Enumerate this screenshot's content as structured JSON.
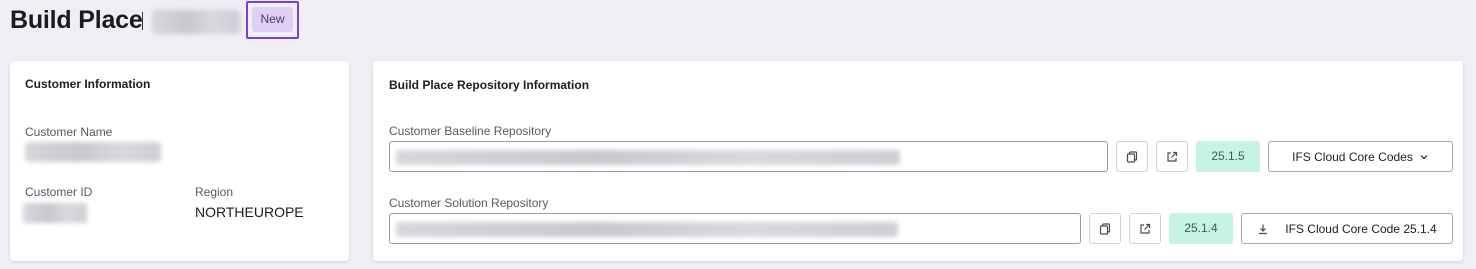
{
  "header": {
    "title": "Build Place",
    "status_badge": "New"
  },
  "customer_card": {
    "title": "Customer Information",
    "name_label": "Customer Name",
    "id_label": "Customer ID",
    "region_label": "Region",
    "region_value": "NORTHEUROPE"
  },
  "repo_card": {
    "title": "Build Place Repository Information",
    "baseline": {
      "label": "Customer Baseline Repository",
      "version": "25.1.5",
      "action_label": "IFS Cloud Core Codes",
      "action_icon": "chevron-down-icon"
    },
    "solution": {
      "label": "Customer Solution Repository",
      "version": "25.1.4",
      "action_label": "IFS Cloud Core Code 25.1.4",
      "action_icon": "download-icon"
    }
  },
  "colors": {
    "badge_bg": "#ddd0f4",
    "badge_frame": "#7b3fd1",
    "version_bg": "#c6f3e2"
  }
}
